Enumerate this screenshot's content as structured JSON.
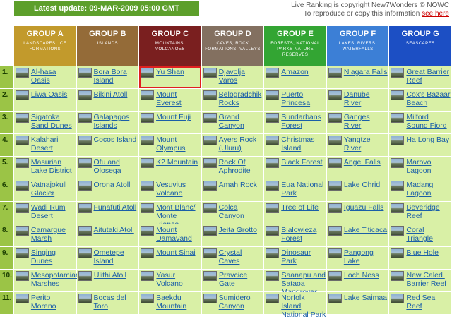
{
  "banner": {
    "latest_update": "Latest update: 09-MAR-2009 05:00 GMT"
  },
  "notice": {
    "line1": "Live Ranking is copyright New7Wonders © NOWC",
    "line2_prefix": "To reproduce or copy this information ",
    "line2_link": "see here"
  },
  "groups": [
    {
      "name": "GROUP A",
      "sub": "LANDSCAPES, ICE FORMATIONS",
      "color": "#c29a2c"
    },
    {
      "name": "GROUP B",
      "sub": "ISLANDS",
      "color": "#946b38"
    },
    {
      "name": "GROUP C",
      "sub": "MOUNTAINS, VOLCANOES",
      "color": "#7a1f1f"
    },
    {
      "name": "GROUP D",
      "sub": "CAVES, ROCK FORMATIONS, VALLEYS",
      "color": "#837060"
    },
    {
      "name": "GROUP E",
      "sub": "FORESTS, NATIONAL PARKS NATURE RESERVES",
      "color": "#33a533"
    },
    {
      "name": "GROUP F",
      "sub": "LAKES, RIVERS, WATERFALLS",
      "color": "#3c7fd6"
    },
    {
      "name": "GROUP G",
      "sub": "SEASCAPES",
      "color": "#1c4fc4"
    }
  ],
  "rows": [
    {
      "rank": "1.",
      "cells": [
        "Al-hasa Oasis",
        "Bora Bora Island",
        "Yu Shan",
        "Djavolja Varos",
        "Amazon",
        "Niagara Falls",
        "Great Barrier Reef"
      ]
    },
    {
      "rank": "2.",
      "cells": [
        "Liwa Oasis",
        "Bikini Atoll",
        "Mount Everest",
        "Belogradchik Rocks",
        "Puerto Princesa",
        "Danube River",
        "Cox's Bazaar Beach"
      ]
    },
    {
      "rank": "3.",
      "cells": [
        "Sigatoka Sand Dunes",
        "Galapagos Islands",
        "Mount Fuji",
        "Grand Canyon",
        "Sundarbans Forest",
        "Ganges River",
        "Milford Sound Fiord"
      ]
    },
    {
      "rank": "4.",
      "cells": [
        "Kalahari Desert",
        "Cocos Island",
        "Mount Olympus",
        "Ayers Rock (Uluru)",
        "Christmas Island",
        "Yangtze River",
        "Ha Long Bay"
      ]
    },
    {
      "rank": "5.",
      "cells": [
        "Masurian Lake District",
        "Ofu and Olosega",
        "K2 Mountain",
        "Rock Of Aphrodite",
        "Black Forest",
        "Angel Falls",
        "Marovo Lagoon"
      ]
    },
    {
      "rank": "6.",
      "cells": [
        "Vatnajokull Glacier",
        "Orona Atoll",
        "Vesuvius Volcano",
        "Amah Rock",
        "Eua National Park",
        "Lake Ohrid",
        "Madang Lagoon"
      ]
    },
    {
      "rank": "7.",
      "cells": [
        "Wadi Rum Desert",
        "Funafuti Atoll",
        "Mont Blanc/ Monte Bianco",
        "Colca Canyon",
        "Tree of Life",
        "Iguazu Falls",
        "Beveridge Reef"
      ]
    },
    {
      "rank": "8.",
      "cells": [
        "Camargue Marsh",
        "Aitutaki Atoll",
        "Mount Damavand",
        "Jeita Grotto",
        "Bialowieza Forest",
        "Lake Titicaca",
        "Coral Triangle"
      ]
    },
    {
      "rank": "9.",
      "cells": [
        "Singing Dunes",
        "Ometepe Island",
        "Mount Sinai",
        "Crystal Caves",
        "Dinosaur Park",
        "Pangong Lake",
        "Blue Hole"
      ]
    },
    {
      "rank": "10.",
      "cells": [
        "Mesopotamian Marshes",
        "Ulithi Atoll",
        "Yasur Volcano",
        "Pravcice Gate",
        "Saanapu and Sataoa Mangroves",
        "Loch Ness",
        "New Caled. Barrier Reef"
      ]
    },
    {
      "rank": "11.",
      "cells": [
        "Perito Moreno",
        "Bocas del Toro",
        "Baekdu Mountain",
        "Sumidero Canyon",
        "Norfolk Island National Park",
        "Lake Saimaa",
        "Red Sea Reef"
      ]
    }
  ],
  "selected_cell": "Yu Shan"
}
